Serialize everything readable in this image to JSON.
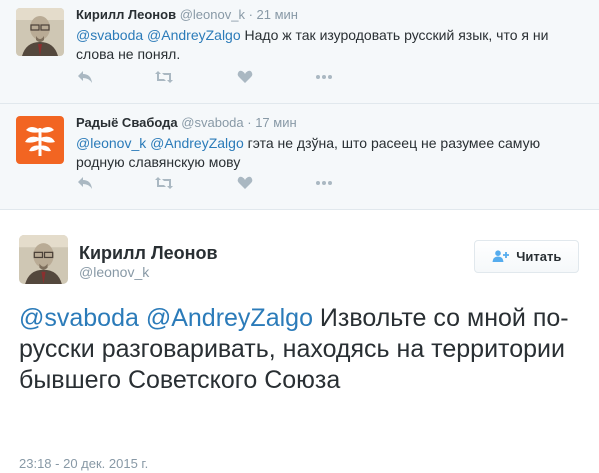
{
  "tweets": [
    {
      "name": "Кирилл Леонов",
      "handle": "@leonov_k",
      "time": "· 21 мин",
      "mentions": "@svaboda @AndreyZalgo",
      "text": " Надо ж так изуродовать русский язык, что я ни слова не понял."
    },
    {
      "name": "Радыё Свабода",
      "handle": "@svaboda",
      "time": "· 17 мин",
      "mentions": "@leonov_k @AndreyZalgo",
      "text": " гэта не дзўна, што расеец не разумее самую родную славянскую мову"
    }
  ],
  "main_tweet": {
    "name": "Кирилл Леонов",
    "handle": "@leonov_k",
    "follow_label": "Читать",
    "mentions": "@svaboda @AndreyZalgo",
    "text": " Извольте со мной по-русски разговаривать, находясь на территории бывшего Советского Союза",
    "timestamp": "23:18 - 20 дек. 2015 г."
  },
  "icons": {
    "reply": "reply-icon",
    "retweet": "retweet-icon",
    "like": "heart-icon",
    "more": "more-icon",
    "follow": "add-user-icon"
  },
  "colors": {
    "link": "#2b7bb9",
    "muted": "#8899a6",
    "icon": "#aab8c2",
    "svaboda_orange": "#f26522"
  }
}
